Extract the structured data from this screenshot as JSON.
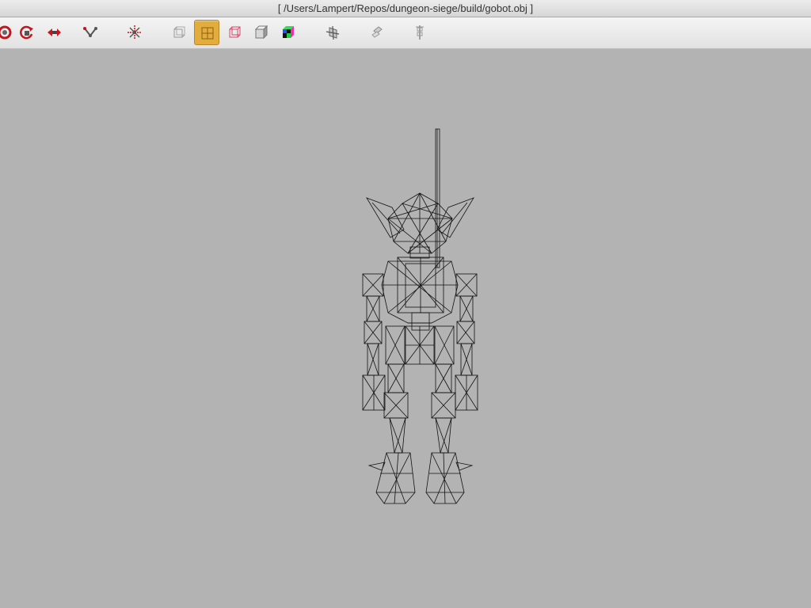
{
  "window": {
    "title": "[ /Users/Lampert/Repos/dungeon-siege/build/gobot.obj ]"
  },
  "toolbar": {
    "tools": [
      {
        "name": "rotate-icon",
        "active": false
      },
      {
        "name": "orbit-icon",
        "active": false
      },
      {
        "name": "pan-icon",
        "active": false
      },
      {
        "name": "translate-icon",
        "active": false
      },
      {
        "name": "scale-icon",
        "active": false
      },
      {
        "name": "bounding-box-icon",
        "active": false
      },
      {
        "name": "wireframe-icon",
        "active": true
      },
      {
        "name": "hidden-line-icon",
        "active": false
      },
      {
        "name": "solid-shading-icon",
        "active": false
      },
      {
        "name": "texture-shading-icon",
        "active": false
      },
      {
        "name": "normals-icon",
        "active": false
      },
      {
        "name": "lighting-icon",
        "active": false
      },
      {
        "name": "skeleton-icon",
        "active": false
      }
    ]
  },
  "colors": {
    "background": "#b3b3b3",
    "wire": "#111111",
    "active_tool": "#e2ad3c"
  }
}
